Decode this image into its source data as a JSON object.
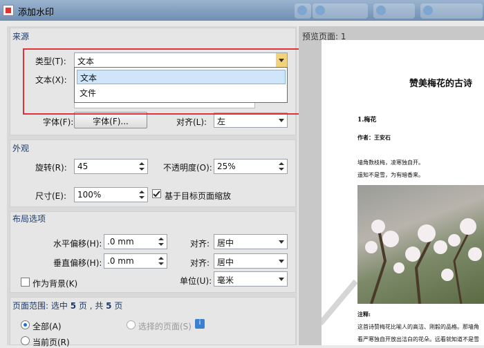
{
  "window": {
    "title": "添加水印"
  },
  "source": {
    "title": "来源",
    "type_label": "类型(T):",
    "type_value": "文本",
    "type_options": [
      "文本",
      "文件"
    ],
    "text_label": "文本(X):",
    "font_label": "字体(F):",
    "font_button": "字体(F)...",
    "align_label": "对齐(L):",
    "align_value": "左"
  },
  "appearance": {
    "title": "外观",
    "rotation_label": "旋转(R):",
    "rotation_value": "45",
    "opacity_label": "不透明度(O):",
    "opacity_value": "25%",
    "size_label": "尺寸(E):",
    "size_value": "100%",
    "scale_label": "基于目标页面缩放",
    "scale_checked": true
  },
  "layout": {
    "title": "布局选项",
    "hoffset_label": "水平偏移(H):",
    "hoffset_value": ".0 mm",
    "voffset_label": "垂直偏移(H):",
    "voffset_value": ".0 mm",
    "halign_label": "对齐:",
    "halign_value": "居中",
    "valign_label": "对齐:",
    "valign_value": "居中",
    "background_label": "作为背景(K)",
    "unit_label": "单位(U):",
    "unit_value": "毫米"
  },
  "page_range": {
    "title_prefix": "页面范围: 选中",
    "selected": "5",
    "mid": "页 , 共",
    "total": "5",
    "suffix": "页",
    "all_label": "全部(A)",
    "selected_label": "选择的页面(S)",
    "current_label": "当前页(R)"
  },
  "preview": {
    "title": "预览页面: 1",
    "doc_title": "赞美梅花的古诗",
    "heading": "1.梅花",
    "author": "作者：王安石",
    "line1": "墙角数枝梅，凌寒独自开。",
    "line2": "遥知不是雪，为有暗香来。",
    "note_label": "注释:",
    "body1": "这首诗赞梅花比喻人的高洁、刚毅的品格。那墙角",
    "body2": "看严寒独自开放出洁白的花朵。远看就知道不是雪"
  },
  "colors": {
    "highlight_border": "#e0313a",
    "selection": "#cfe6fa",
    "group_title": "#1c3b6a"
  }
}
